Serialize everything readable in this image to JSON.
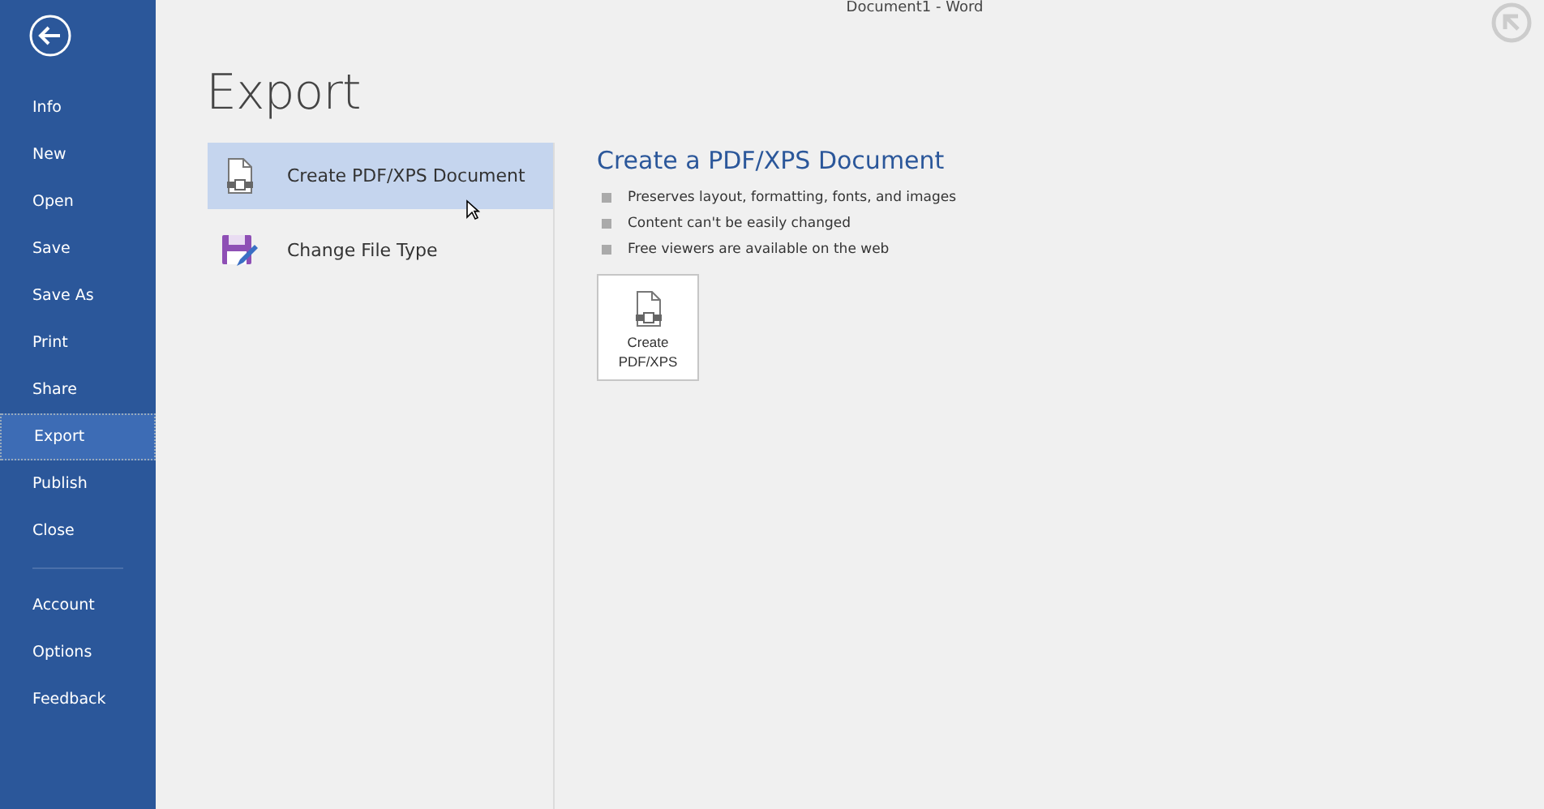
{
  "window": {
    "title": "Document1 - Word"
  },
  "sidebar": {
    "items": [
      {
        "label": "Info",
        "selected": false
      },
      {
        "label": "New",
        "selected": false
      },
      {
        "label": "Open",
        "selected": false
      },
      {
        "label": "Save",
        "selected": false
      },
      {
        "label": "Save As",
        "selected": false
      },
      {
        "label": "Print",
        "selected": false
      },
      {
        "label": "Share",
        "selected": false
      },
      {
        "label": "Export",
        "selected": true
      },
      {
        "label": "Publish",
        "selected": false
      },
      {
        "label": "Close",
        "selected": false
      }
    ],
    "bottom_items": [
      {
        "label": "Account",
        "selected": false
      },
      {
        "label": "Options",
        "selected": false
      },
      {
        "label": "Feedback",
        "selected": false
      }
    ]
  },
  "page_title": "Export",
  "export_options": [
    {
      "label": "Create PDF/XPS Document",
      "kind": "pdf",
      "selected": true
    },
    {
      "label": "Change File Type",
      "kind": "filetype",
      "selected": false
    }
  ],
  "detail": {
    "heading": "Create a PDF/XPS Document",
    "bullets": [
      "Preserves layout, formatting, fonts, and images",
      "Content can't be easily changed",
      "Free viewers are available on the web"
    ],
    "button": "Create PDF/XPS"
  }
}
